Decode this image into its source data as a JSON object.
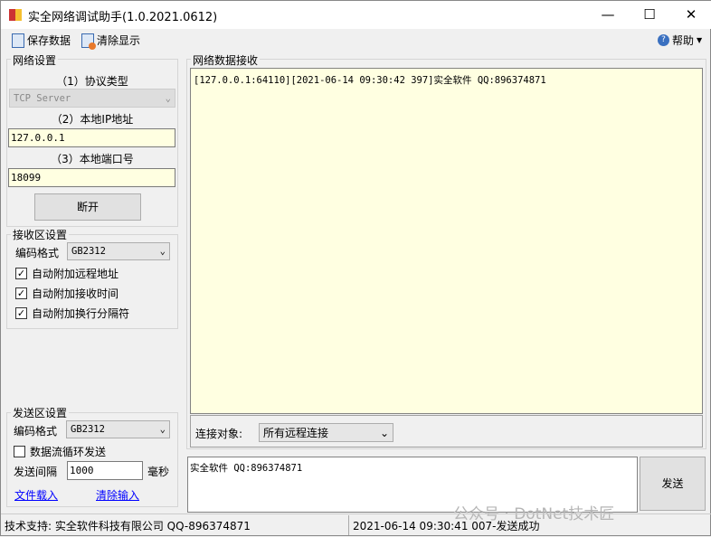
{
  "window": {
    "title": "实全网络调试助手(1.0.2021.0612)",
    "minimize": "—",
    "maximize": "☐",
    "close": "✕"
  },
  "toolbar": {
    "save": "保存数据",
    "clear": "清除显示",
    "help": "帮助"
  },
  "network": {
    "legend": "网络设置",
    "protocol_label": "（1）协议类型",
    "protocol_value": "TCP Server",
    "ip_label": "（2）本地IP地址",
    "ip_value": "127.0.0.1",
    "port_label": "（3）本地端口号",
    "port_value": "18099",
    "disconnect": "断开"
  },
  "recv_settings": {
    "legend": "接收区设置",
    "encoding_label": "编码格式",
    "encoding_value": "GB2312",
    "options": [
      {
        "label": "自动附加远程地址",
        "checked": true
      },
      {
        "label": "自动附加接收时间",
        "checked": true
      },
      {
        "label": "自动附加换行分隔符",
        "checked": true
      }
    ]
  },
  "send_settings": {
    "legend": "发送区设置",
    "encoding_label": "编码格式",
    "encoding_value": "GB2312",
    "loop_label": "数据流循环发送",
    "interval_label": "发送间隔",
    "interval_value": "1000",
    "interval_unit": "毫秒",
    "file_load": "文件载入",
    "clear_input": "清除输入"
  },
  "receive": {
    "legend": "网络数据接收",
    "content": "[127.0.0.1:64110][2021-06-14 09:30:42 397]实全软件 QQ:896374871",
    "target_label": "连接对象:",
    "target_value": "所有远程连接"
  },
  "send": {
    "content": "实全软件 QQ:896374871",
    "button": "发送"
  },
  "watermark": "公众号 · DotNet技术匠",
  "status": {
    "left": "技术支持: 实全软件科技有限公司 QQ-896374871",
    "right": "2021-06-14 09:30:41 007-发送成功"
  }
}
